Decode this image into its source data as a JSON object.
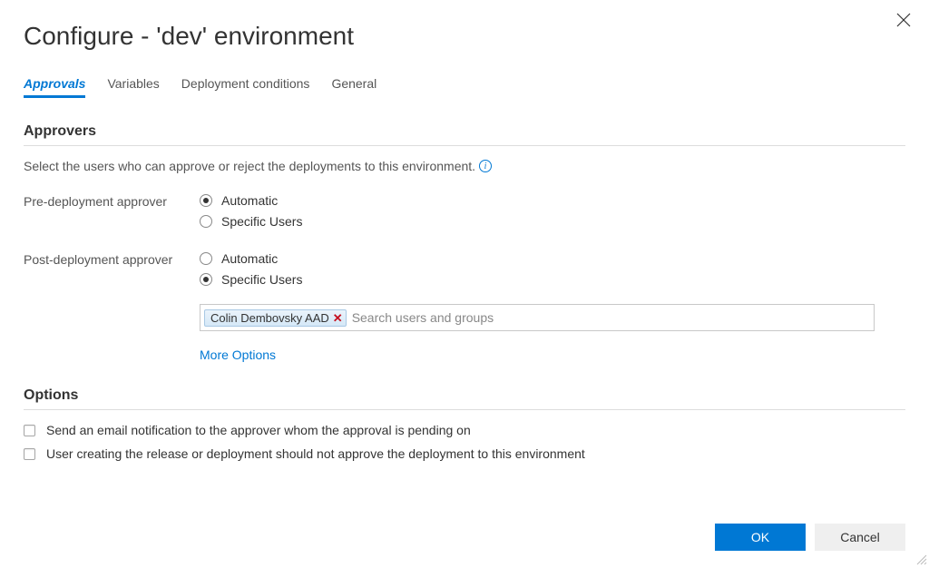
{
  "dialog": {
    "title": "Configure - 'dev' environment"
  },
  "tabs": {
    "approvals": "Approvals",
    "variables": "Variables",
    "deployment_conditions": "Deployment conditions",
    "general": "General"
  },
  "approvers": {
    "heading": "Approvers",
    "help_text": "Select the users who can approve or reject the deployments to this environment.",
    "pre_label": "Pre-deployment approver",
    "post_label": "Post-deployment approver",
    "radio_automatic": "Automatic",
    "radio_specific": "Specific Users",
    "selected_user": "Colin Dembovsky AAD",
    "search_placeholder": "Search users and groups",
    "more_options": "More Options"
  },
  "options": {
    "heading": "Options",
    "opt_email": "Send an email notification to the approver whom the approval is pending on",
    "opt_creator": "User creating the release or deployment should not approve the deployment to this environment"
  },
  "buttons": {
    "ok": "OK",
    "cancel": "Cancel"
  }
}
